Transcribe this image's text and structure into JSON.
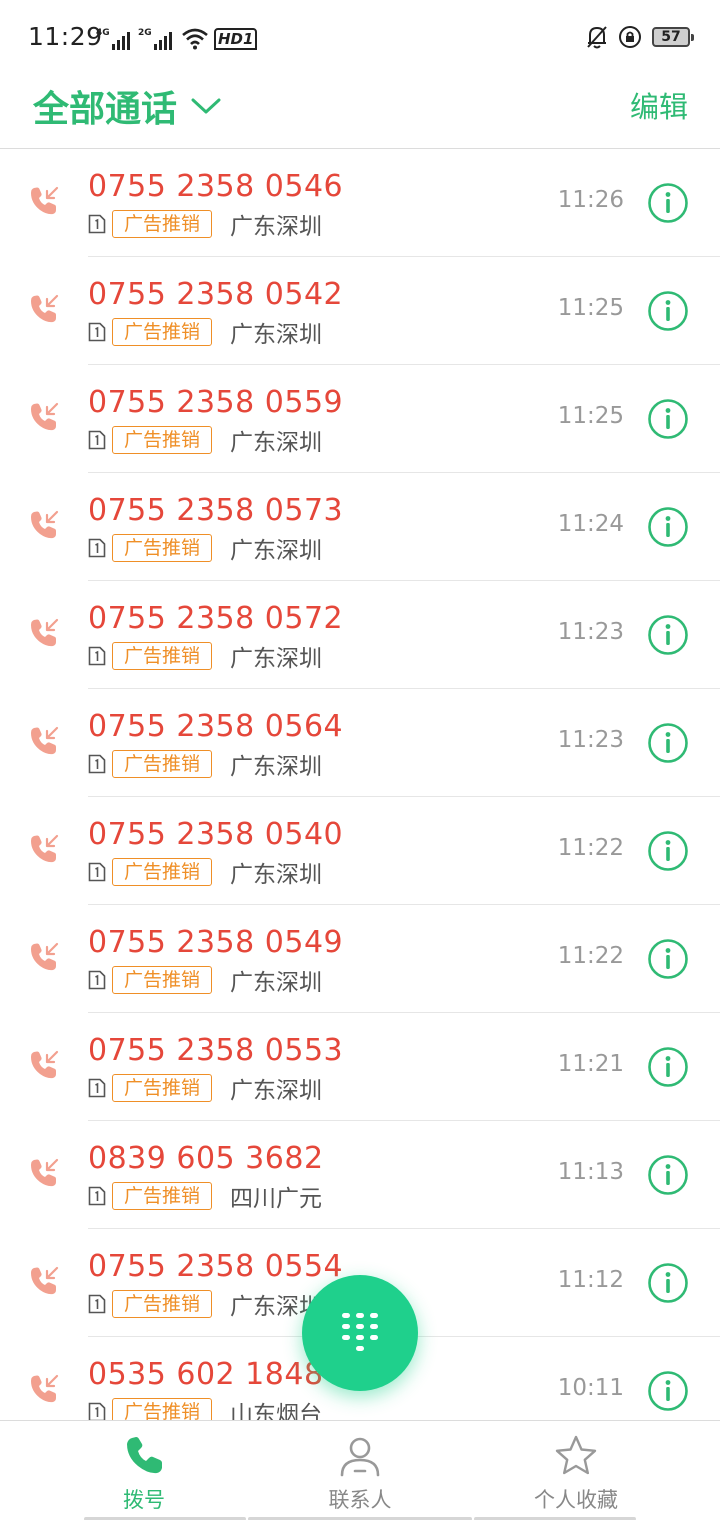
{
  "status_bar": {
    "time": "11:29",
    "signal_1_label": "4G",
    "signal_2_label": "2G",
    "hd_label": "HD1",
    "battery": "57"
  },
  "header": {
    "title": "全部通话",
    "edit_label": "编辑"
  },
  "calls": [
    {
      "number": "0755 2358 0546",
      "tag": "广告推销",
      "location": "广东深圳",
      "time": "11:26"
    },
    {
      "number": "0755 2358 0542",
      "tag": "广告推销",
      "location": "广东深圳",
      "time": "11:25"
    },
    {
      "number": "0755 2358 0559",
      "tag": "广告推销",
      "location": "广东深圳",
      "time": "11:25"
    },
    {
      "number": "0755 2358 0573",
      "tag": "广告推销",
      "location": "广东深圳",
      "time": "11:24"
    },
    {
      "number": "0755 2358 0572",
      "tag": "广告推销",
      "location": "广东深圳",
      "time": "11:23"
    },
    {
      "number": "0755 2358 0564",
      "tag": "广告推销",
      "location": "广东深圳",
      "time": "11:23"
    },
    {
      "number": "0755 2358 0540",
      "tag": "广告推销",
      "location": "广东深圳",
      "time": "11:22"
    },
    {
      "number": "0755 2358 0549",
      "tag": "广告推销",
      "location": "广东深圳",
      "time": "11:22"
    },
    {
      "number": "0755 2358 0553",
      "tag": "广告推销",
      "location": "广东深圳",
      "time": "11:21"
    },
    {
      "number": "0839 605 3682",
      "tag": "广告推销",
      "location": "四川广元",
      "time": "11:13"
    },
    {
      "number": "0755 2358 0554",
      "tag": "广告推销",
      "location": "广东深圳",
      "time": "11:12"
    },
    {
      "number": "0535 602 1848",
      "tag": "广告推销",
      "location": "山东烟台",
      "time": "10:11"
    }
  ],
  "nav": {
    "dial_label": "拨号",
    "contacts_label": "联系人",
    "favorites_label": "个人收藏"
  },
  "colors": {
    "accent": "#2fba74",
    "missed_number": "#e5473a",
    "tag": "#ef8f27",
    "fab": "#1fd08c"
  },
  "icons": {
    "call_type": "missed-incoming-call-icon",
    "sim": "sim-1-icon",
    "info": "info-circle-icon",
    "fab": "dialpad-icon"
  }
}
